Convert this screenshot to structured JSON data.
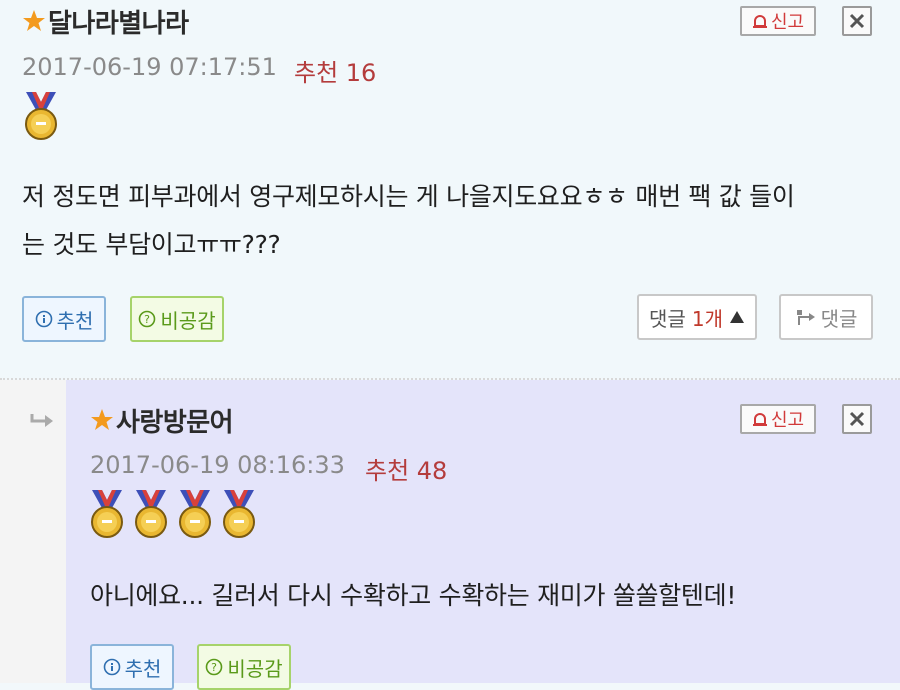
{
  "comments": [
    {
      "author": "달나라별나라",
      "date": "2017-06-19 07:17:51",
      "recommend": "추천 16",
      "medal_count": 1,
      "body_line1": "저 정도면 피부과에서 영구제모하시는 게 나을지도요요ㅎㅎ 매번 팩 값 들이",
      "body_line2": "는 것도 부담이고ㅠㅠ???",
      "report_label": "신고",
      "recommend_btn": "추천",
      "disrecommend_btn": "비공감",
      "reply_count_label": "댓글",
      "reply_count": "1개",
      "reply_btn": "댓글"
    },
    {
      "author": "사랑방문어",
      "date": "2017-06-19 08:16:33",
      "recommend": "추천 48",
      "medal_count": 4,
      "body_line1": "아니에요... 길러서 다시 수확하고 수확하는 재미가 쏠쏠할텐데!",
      "report_label": "신고",
      "recommend_btn": "추천",
      "disrecommend_btn": "비공감"
    }
  ],
  "colors": {
    "comment_bg": "#f1f8fb",
    "reply_bg": "#e4e4fa",
    "recommend_red": "#b43c3c",
    "star_orange": "#f39a1e"
  },
  "icons": [
    "star-icon",
    "medal-icon",
    "siren-icon",
    "close-icon",
    "info-icon",
    "question-icon",
    "triangle-up-icon",
    "reply-arrow-icon",
    "indent-arrow-icon"
  ]
}
